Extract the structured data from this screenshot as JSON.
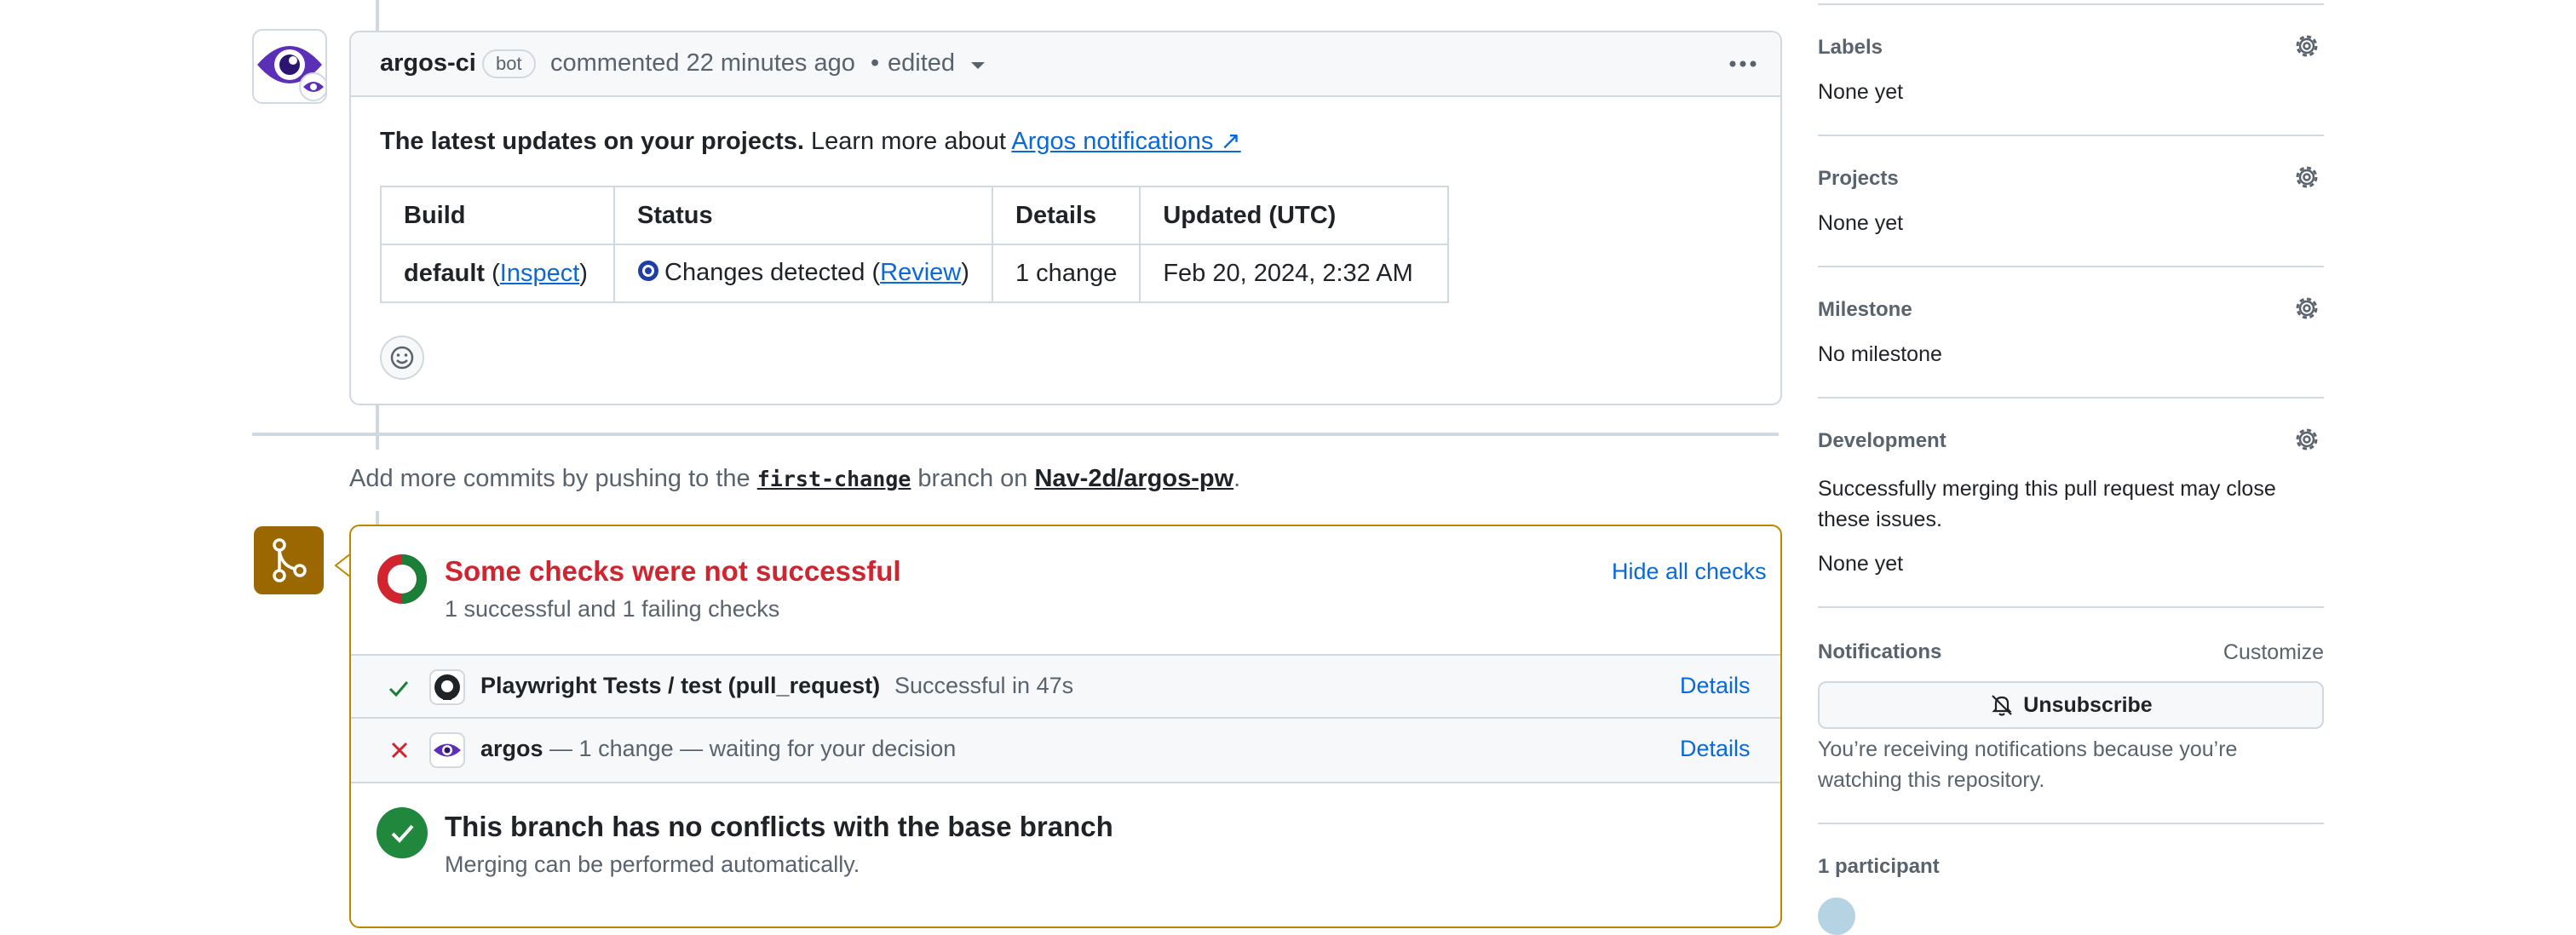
{
  "comment": {
    "author": "argos-ci",
    "badge": "bot",
    "meta": "commented 22 minutes ago",
    "edited": "edited",
    "intro_bold": "The latest updates on your projects.",
    "intro_rest": " Learn more about ",
    "intro_link": "Argos notifications ↗",
    "table": {
      "headers": [
        "Build",
        "Status",
        "Details",
        "Updated (UTC)"
      ],
      "row": {
        "build": "default",
        "build_link": "Inspect",
        "status": "Changes detected",
        "status_link": "Review",
        "details": "1 change",
        "updated": "Feb 20, 2024, 2:32 AM"
      }
    }
  },
  "push_hint": {
    "prefix": "Add more commits by pushing to the ",
    "branch": "first-change",
    "middle": " branch on ",
    "repo": "Nav-2d/argos-pw",
    "suffix": "."
  },
  "checks": {
    "title": "Some checks were not successful",
    "subtitle": "1 successful and 1 failing checks",
    "hide_label": "Hide all checks",
    "items": [
      {
        "name": "Playwright Tests / test (pull_request)",
        "desc": "Successful in 47s",
        "details": "Details"
      },
      {
        "name": "argos",
        "desc": "— 1 change — waiting for your decision",
        "details": "Details"
      }
    ],
    "merge_title": "This branch has no conflicts with the base branch",
    "merge_subtitle": "Merging can be performed automatically."
  },
  "sidebar": {
    "labels": {
      "title": "Labels",
      "value": "None yet"
    },
    "projects": {
      "title": "Projects",
      "value": "None yet"
    },
    "milestone": {
      "title": "Milestone",
      "value": "No milestone"
    },
    "development": {
      "title": "Development",
      "text": "Successfully merging this pull request may close these issues.",
      "value": "None yet"
    },
    "notifications": {
      "title": "Notifications",
      "customize": "Customize",
      "button": "Unsubscribe",
      "text": "You’re receiving notifications because you’re watching this repository."
    },
    "participants": {
      "title": "1 participant"
    }
  },
  "colors": {
    "accent": "#0969da",
    "danger": "#d1242f",
    "success": "#1a7f37",
    "attention": "#9a6700"
  }
}
